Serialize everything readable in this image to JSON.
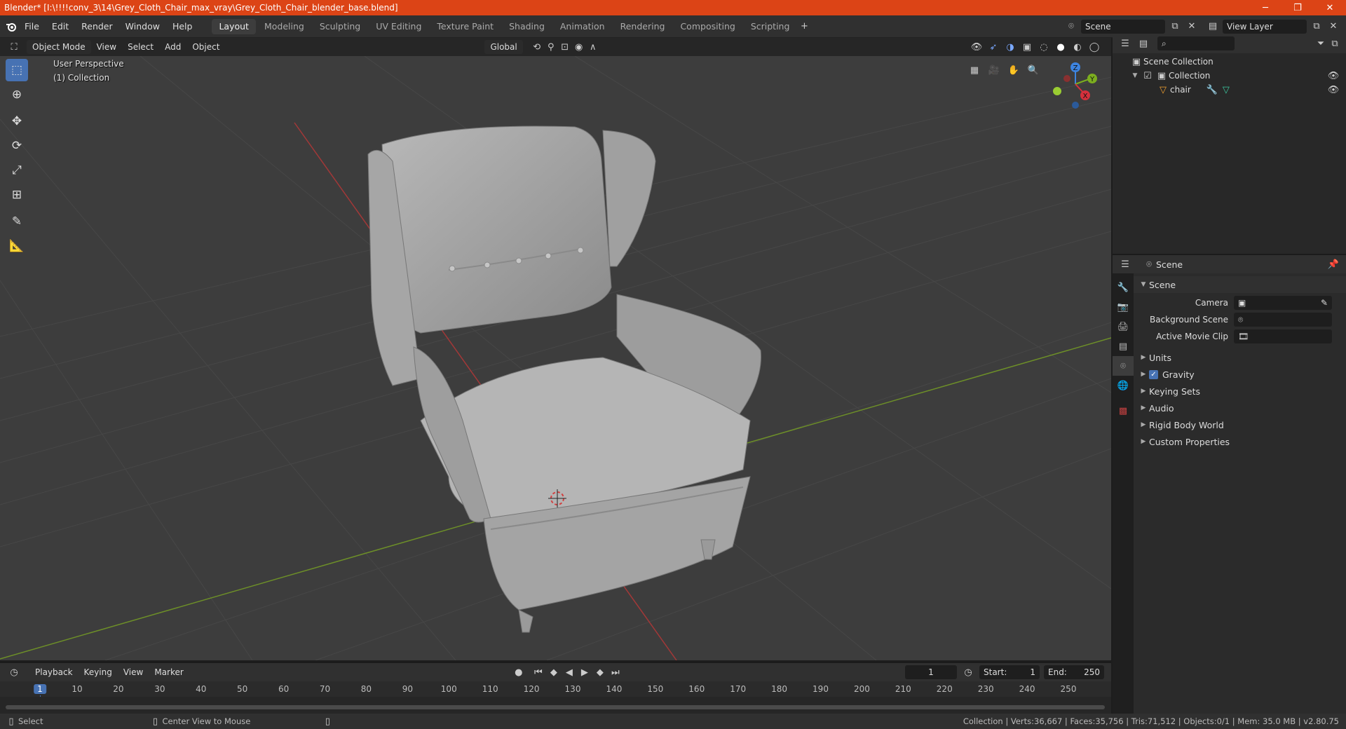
{
  "window": {
    "title": "Blender* [I:\\!!!!conv_3\\14\\Grey_Cloth_Chair_max_vray\\Grey_Cloth_Chair_blender_base.blend]",
    "minimize": "─",
    "restore": "❐",
    "close": "✕"
  },
  "menu": [
    "File",
    "Edit",
    "Render",
    "Window",
    "Help"
  ],
  "workspaces": [
    "Layout",
    "Modeling",
    "Sculpting",
    "UV Editing",
    "Texture Paint",
    "Shading",
    "Animation",
    "Rendering",
    "Compositing",
    "Scripting"
  ],
  "scene_selector": {
    "value": "Scene"
  },
  "view_layer_selector": {
    "value": "View Layer"
  },
  "viewport": {
    "mode": "Object Mode",
    "menus": [
      "View",
      "Select",
      "Add",
      "Object"
    ],
    "transform_orientation": "Global",
    "overlay_line1": "User Perspective",
    "overlay_line2": "(1) Collection",
    "gizmo_axes": {
      "z": "Z",
      "y": "Y",
      "x": "X"
    }
  },
  "outliner": {
    "root": "Scene Collection",
    "collection": "Collection",
    "object": "chair"
  },
  "properties": {
    "header": "Scene",
    "panel_title": "Scene",
    "camera_label": "Camera",
    "background_scene_label": "Background Scene",
    "active_movie_clip_label": "Active Movie Clip",
    "subpanels": [
      "Units",
      "Gravity",
      "Keying Sets",
      "Audio",
      "Rigid Body World",
      "Custom Properties"
    ],
    "gravity_checked": true
  },
  "timeline": {
    "menus": [
      "Playback",
      "Keying",
      "View",
      "Marker"
    ],
    "current_frame": "1",
    "start_label": "Start:",
    "start_value": "1",
    "end_label": "End:",
    "end_value": "250",
    "ruler_ticks": [
      "1",
      "10",
      "20",
      "30",
      "40",
      "50",
      "60",
      "70",
      "80",
      "90",
      "100",
      "110",
      "120",
      "130",
      "140",
      "150",
      "160",
      "170",
      "180",
      "190",
      "200",
      "210",
      "220",
      "230",
      "240",
      "250"
    ]
  },
  "statusbar": {
    "select": "Select",
    "center_view": "Center View to Mouse",
    "stats": "Collection | Verts:36,667 | Faces:35,756 | Tris:71,512 | Objects:0/1 | Mem: 35.0 MB | v2.80.75"
  },
  "colors": {
    "titlebar": "#dc4416",
    "accent": "#4772b3",
    "x_axis": "#d5303c",
    "y_axis": "#7cae1f",
    "z_axis": "#3d84e0"
  }
}
